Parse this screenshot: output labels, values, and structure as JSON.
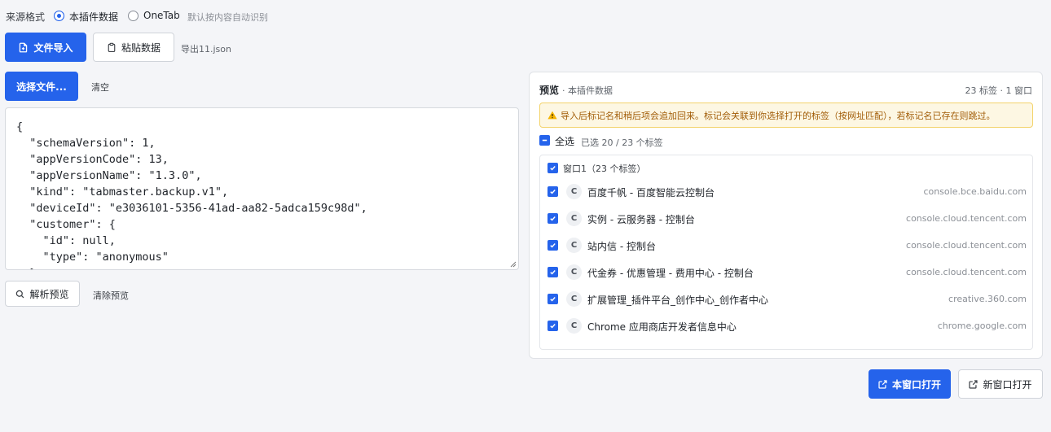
{
  "source_format": {
    "label": "来源格式",
    "options": [
      {
        "label": "本插件数据",
        "selected": true
      },
      {
        "label": "OneTab",
        "selected": false
      }
    ],
    "hint": "默认按内容自动识别"
  },
  "toolbar": {
    "file_import_label": "文件导入",
    "paste_label": "粘贴数据",
    "export_filename": "导出11.json"
  },
  "file": {
    "choose_label": "选择文件...",
    "clear_label": "清空"
  },
  "json_text": "{\n  \"schemaVersion\": 1,\n  \"appVersionCode\": 13,\n  \"appVersionName\": \"1.3.0\",\n  \"kind\": \"tabmaster.backup.v1\",\n  \"deviceId\": \"e3036101-5356-41ad-aa82-5adca159c98d\",\n  \"customer\": {\n    \"id\": null,\n    \"type\": \"anonymous\"\n  },",
  "actions": {
    "parse_label": "解析预览",
    "clear_preview_label": "清除预览",
    "open_here_label": "本窗口打开",
    "open_new_label": "新窗口打开"
  },
  "preview": {
    "title": "预览",
    "subtitle": "· 本插件数据",
    "counts": "23 标签 · 1 窗口",
    "warning": "导入后标记名和稍后项会追加回来。标记会关联到你选择打开的标签（按网址匹配），若标记名已存在则跳过。",
    "select_all_label": "全选",
    "selected_count": "已选 20 / 23 个标签",
    "window_label": "窗口1（23 个标签）",
    "tabs": [
      {
        "favicon": "C",
        "title": "百度千帆 - 百度智能云控制台",
        "domain": "console.bce.baidu.com",
        "checked": true
      },
      {
        "favicon": "C",
        "title": "实例 - 云服务器 - 控制台",
        "domain": "console.cloud.tencent.com",
        "checked": true
      },
      {
        "favicon": "C",
        "title": "站内信 - 控制台",
        "domain": "console.cloud.tencent.com",
        "checked": true
      },
      {
        "favicon": "C",
        "title": "代金券 - 优惠管理 - 费用中心 - 控制台",
        "domain": "console.cloud.tencent.com",
        "checked": true
      },
      {
        "favicon": "C",
        "title": "扩展管理_插件平台_创作中心_创作者中心",
        "domain": "creative.360.com",
        "checked": true
      },
      {
        "favicon": "C",
        "title": "Chrome 应用商店开发者信息中心",
        "domain": "chrome.google.com",
        "checked": true
      }
    ]
  },
  "colors": {
    "primary": "#2563eb",
    "warning_bg": "#fdf7e3",
    "warning_text": "#a15c07"
  }
}
